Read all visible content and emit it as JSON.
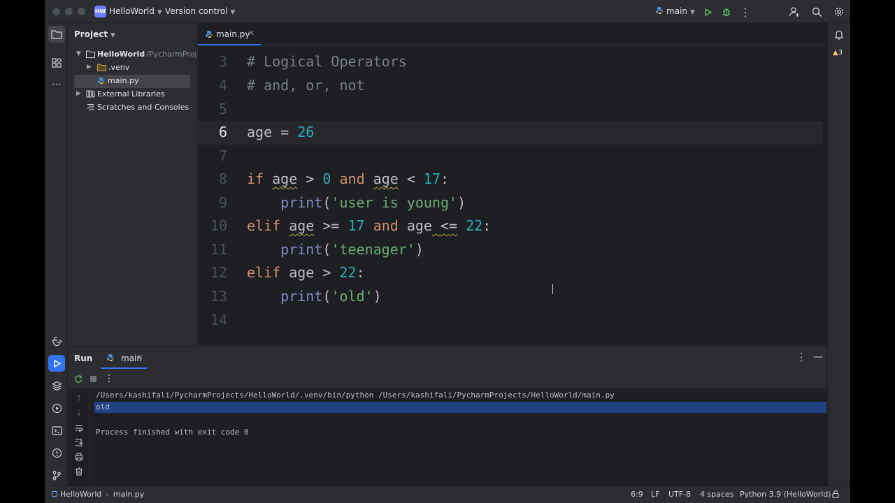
{
  "titlebar": {
    "project_badge": "HW",
    "project_name": "HelloWorld",
    "vcs": "Version control",
    "run_config": "main"
  },
  "project_panel": {
    "title": "Project",
    "tree": [
      {
        "label": "HelloWorld",
        "suffix": "~/PycharmProjects/HelloWorld"
      },
      {
        "label": ".venv"
      },
      {
        "label": "main.py"
      },
      {
        "label": "External Libraries"
      },
      {
        "label": "Scratches and Consoles"
      }
    ]
  },
  "editor": {
    "tab_label": "main.py",
    "warning_count": "3",
    "lines": [
      {
        "n": "3",
        "code": "# Logical Operators"
      },
      {
        "n": "4",
        "code": "# and, or, not"
      },
      {
        "n": "5",
        "code": ""
      },
      {
        "n": "6",
        "code": "age = 26"
      },
      {
        "n": "7",
        "code": ""
      },
      {
        "n": "8",
        "code": "if age > 0 and age < 17:"
      },
      {
        "n": "9",
        "code": "    print('user is young')"
      },
      {
        "n": "10",
        "code": "elif age >= 17 and age <= 22:"
      },
      {
        "n": "11",
        "code": "    print('teenager')"
      },
      {
        "n": "12",
        "code": "elif age > 22:"
      },
      {
        "n": "13",
        "code": "    print('old')"
      },
      {
        "n": "14",
        "code": ""
      }
    ]
  },
  "run_panel": {
    "title": "Run",
    "tab_label": "main",
    "console": [
      "/Users/kashifali/PycharmProjects/HelloWorld/.venv/bin/python /Users/kashifali/PycharmProjects/HelloWorld/main.py",
      "old",
      "",
      "Process finished with exit code 0"
    ]
  },
  "statusbar": {
    "breadcrumb_project": "HelloWorld",
    "breadcrumb_file": "main.py",
    "position": "6:9",
    "line_sep": "LF",
    "encoding": "UTF-8",
    "indent": "4 spaces",
    "interpreter": "Python 3.9 (HelloWorld)"
  },
  "colors": {
    "accent": "#3574f0",
    "keyword": "#cf8e6d",
    "number": "#2aacb8",
    "string": "#6aab73",
    "builtin": "#8888c6",
    "comment": "#7a7e85"
  }
}
